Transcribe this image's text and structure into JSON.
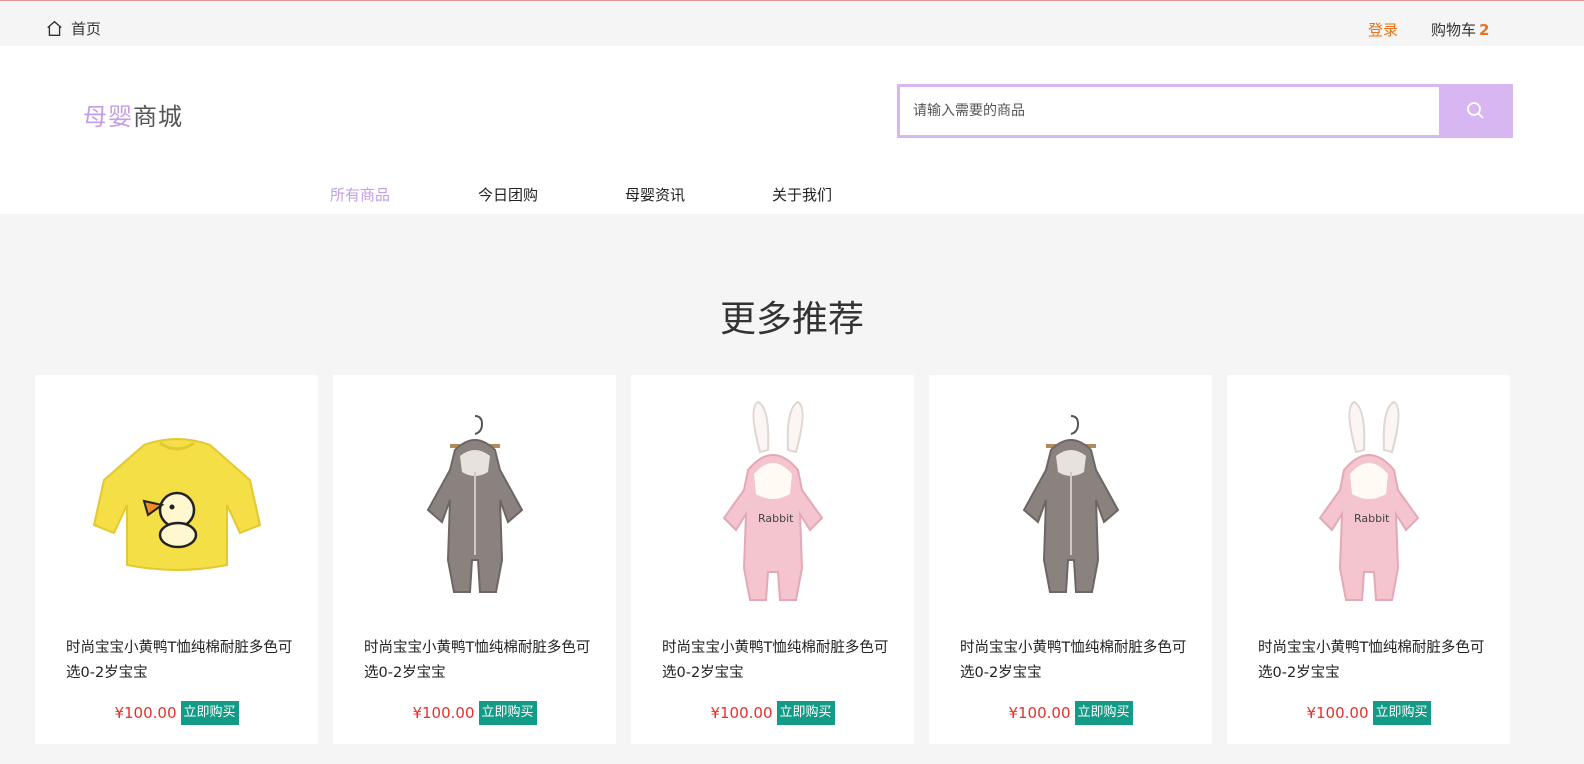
{
  "topbar": {
    "home_label": "首页",
    "login_label": "登录",
    "cart_label": "购物车",
    "cart_count": "2"
  },
  "logo": {
    "part1": "母婴",
    "part2": "商城"
  },
  "search": {
    "placeholder": "请输入需要的商品",
    "value": ""
  },
  "nav": {
    "items": [
      "所有商品",
      "今日团购",
      "母婴资讯",
      "关于我们"
    ],
    "active_index": 0
  },
  "section": {
    "title": "更多推荐"
  },
  "products": [
    {
      "title": "时尚宝宝小黄鸭T恤纯棉耐脏多色可选0-2岁宝宝",
      "price": "¥100.00",
      "buy_label": "立即购买",
      "image": "yellow-duck-shirt"
    },
    {
      "title": "时尚宝宝小黄鸭T恤纯棉耐脏多色可选0-2岁宝宝",
      "price": "¥100.00",
      "buy_label": "立即购买",
      "image": "gray-fleece-romper"
    },
    {
      "title": "时尚宝宝小黄鸭T恤纯棉耐脏多色可选0-2岁宝宝",
      "price": "¥100.00",
      "buy_label": "立即购买",
      "image": "pink-rabbit-romper"
    },
    {
      "title": "时尚宝宝小黄鸭T恤纯棉耐脏多色可选0-2岁宝宝",
      "price": "¥100.00",
      "buy_label": "立即购买",
      "image": "gray-fleece-romper"
    },
    {
      "title": "时尚宝宝小黄鸭T恤纯棉耐脏多色可选0-2岁宝宝",
      "price": "¥100.00",
      "buy_label": "立即购买",
      "image": "pink-rabbit-romper"
    }
  ],
  "colors": {
    "accent": "#d7b6f2",
    "logo": "#c39ee6",
    "price": "#e7302a",
    "buy_button": "#129b86",
    "login": "#e8731a"
  }
}
